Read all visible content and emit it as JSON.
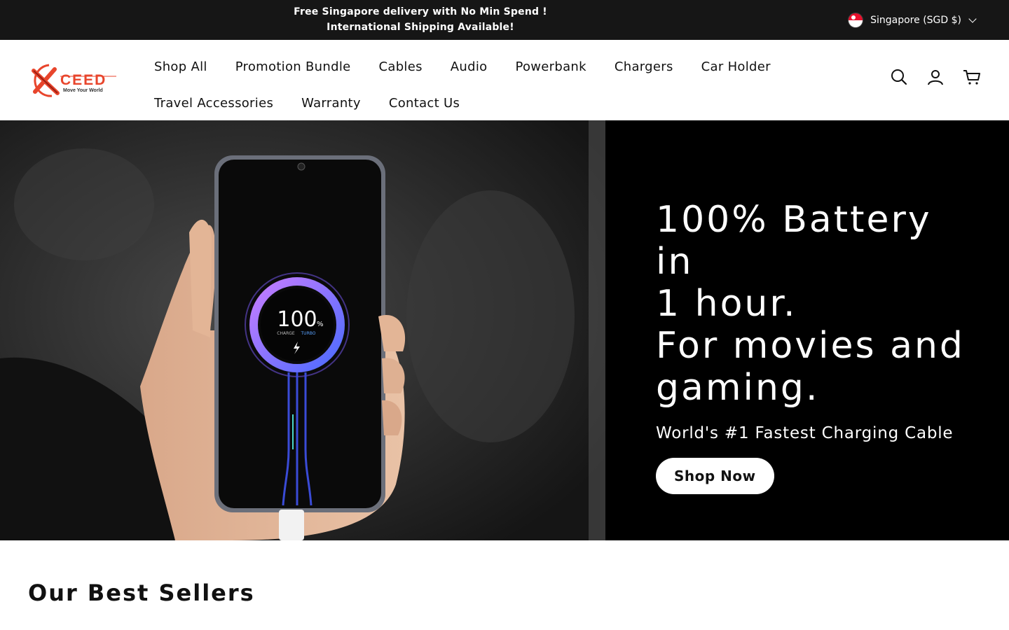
{
  "announcement": {
    "line1": "Free Singapore delivery with No Min Spend !",
    "line2": "International Shipping Available!"
  },
  "locale": {
    "label": "Singapore (SGD $)",
    "flag_icon": "singapore-flag-icon"
  },
  "logo": {
    "brand": "CEED",
    "tagline": "Move Your World",
    "accent_color": "#e8452c"
  },
  "nav": {
    "row1": [
      "Shop All",
      "Promotion Bundle",
      "Cables",
      "Audio",
      "Powerbank",
      "Chargers",
      "Car Holder"
    ],
    "row2": [
      "Travel Accessories",
      "Warranty",
      "Contact Us"
    ]
  },
  "header_icons": [
    "search-icon",
    "account-icon",
    "cart-icon"
  ],
  "hero": {
    "title_line1": "100% Battery in",
    "title_line2": "1 hour.",
    "title_line3": "For movies and",
    "title_line4": "gaming.",
    "subtitle": "World's #1 Fastest Charging Cable",
    "cta": "Shop Now",
    "screen_percent": "100",
    "screen_percent_sign": "%",
    "screen_caption_1": "CHARGE",
    "screen_caption_2": "TURBO"
  },
  "best_sellers": {
    "title": "Our Best Sellers"
  },
  "colors": {
    "topbar_bg": "#161616",
    "hero_bg": "#000000",
    "brand_red": "#e8452c"
  }
}
